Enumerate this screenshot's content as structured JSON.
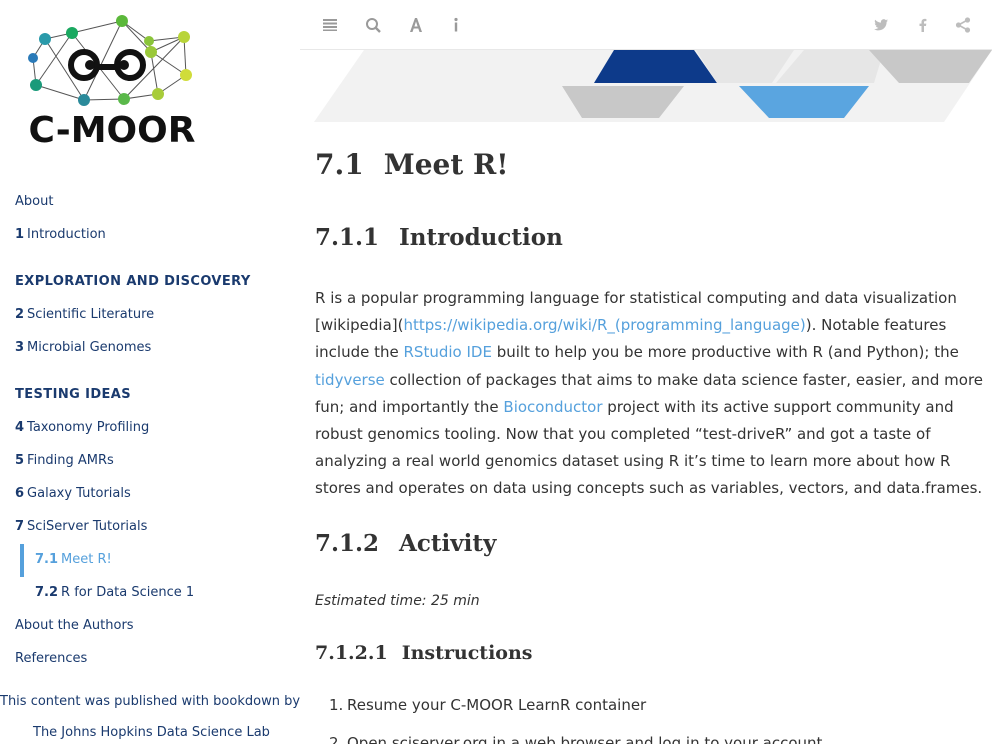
{
  "logo": {
    "text": "C-MOOR"
  },
  "sidebar": {
    "items": [
      {
        "kind": "item",
        "num": "",
        "label": "About"
      },
      {
        "kind": "item",
        "num": "1",
        "label": "Introduction"
      },
      {
        "kind": "part",
        "label": "EXPLORATION AND DISCOVERY"
      },
      {
        "kind": "item",
        "num": "2",
        "label": "Scientific Literature"
      },
      {
        "kind": "item",
        "num": "3",
        "label": "Microbial Genomes"
      },
      {
        "kind": "part",
        "label": "TESTING IDEAS"
      },
      {
        "kind": "item",
        "num": "4",
        "label": "Taxonomy Profiling"
      },
      {
        "kind": "item",
        "num": "5",
        "label": "Finding AMRs"
      },
      {
        "kind": "item",
        "num": "6",
        "label": "Galaxy Tutorials"
      },
      {
        "kind": "item",
        "num": "7",
        "label": "SciServer Tutorials"
      },
      {
        "kind": "sub",
        "num": "7.1",
        "label": "Meet R!",
        "active": true
      },
      {
        "kind": "sub",
        "num": "7.2",
        "label": "R for Data Science 1"
      },
      {
        "kind": "item",
        "num": "",
        "label": "About the Authors"
      },
      {
        "kind": "item",
        "num": "",
        "label": "References"
      }
    ],
    "published_by": "This content was published with bookdown by:",
    "publisher": "The Johns Hopkins Data Science Lab"
  },
  "toolbar": {
    "left_icons": [
      "menu-icon",
      "search-icon",
      "font-icon",
      "info-icon"
    ],
    "right_icons": [
      "twitter-icon",
      "facebook-icon",
      "share-icon"
    ]
  },
  "content": {
    "h1_num": "7.1",
    "h1_text": "Meet R!",
    "h2_intro_num": "7.1.1",
    "h2_intro_text": "Introduction",
    "intro": {
      "t1": "R is a popular programming language for statistical computing and data visualization [wikipedia](",
      "link1": "https://wikipedia.org/wiki/R_(programming_language)",
      "t2": "). Notable features include the ",
      "link2": "RStudio IDE",
      "t3": " built to help you be more productive with R (and Python); the ",
      "link3": "tidyverse",
      "t4": " collection of packages that aims to make data science faster, easier, and more fun; and importantly the ",
      "link4": "Bioconductor",
      "t5": " project with its active support community and robust genomics tooling. Now that you completed “test-driveR” and got a taste of analyzing a real world genomics dataset using R it’s time to learn more about how R stores and operates on data using concepts such as variables, vectors, and data.frames."
    },
    "h2_activity_num": "7.1.2",
    "h2_activity_text": "Activity",
    "estimated": "Estimated time: 25 min",
    "h3_num": "7.1.2.1",
    "h3_text": "Instructions",
    "steps": [
      {
        "n": "1.",
        "text": "Resume your C-MOOR LearnR container"
      },
      {
        "n": "2.",
        "text": "Open sciserver.org in a web browser and log in to your account"
      }
    ]
  },
  "colors": {
    "nav_link": "#1a3a6e",
    "active_link": "#55a0dc",
    "banner_dark": "#0d3a8a",
    "banner_light": "#5aa5e0",
    "banner_grey": "#c8c8c8"
  }
}
